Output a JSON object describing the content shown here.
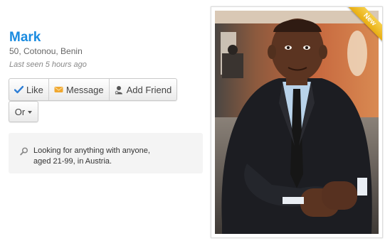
{
  "profile": {
    "name": "Mark",
    "meta": "50, Cotonou, Benin",
    "last_seen": "Last seen 5 hours ago"
  },
  "actions": {
    "like_label": "Like",
    "message_label": "Message",
    "add_friend_label": "Add Friend",
    "or_label": "Or"
  },
  "looking": {
    "text_line1": "Looking for anything with anyone,",
    "text_line2": "aged 21-99, in Austria."
  },
  "photo": {
    "badge": "New"
  },
  "colors": {
    "name": "#1a8be0",
    "like_check": "#2f7fd6",
    "message_icon": "#f0a830",
    "badge": "#f0bf2a"
  }
}
